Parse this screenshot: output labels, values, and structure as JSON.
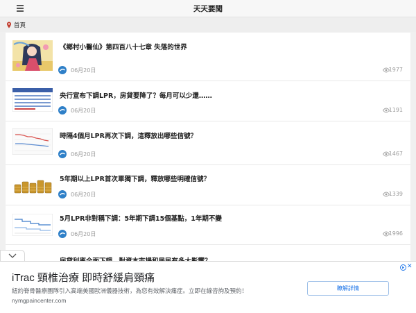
{
  "header": {
    "title": "天天要聞",
    "menu_icon": "hamburger-menu-icon"
  },
  "breadcrumb": {
    "icon": "location-pin-icon",
    "label": "首頁"
  },
  "articles": [
    {
      "title": "《鄉村小醫仙》第四百八十七章 失落的世界",
      "date": "06月20日",
      "views": "1977",
      "thumb": "anime-girl-thumbnail"
    },
    {
      "title": "央行宣布下調LPR，房貸要降了？每月可以少還……",
      "date": "06月20日",
      "views": "1191",
      "thumb": "rate-table-thumbnail"
    },
    {
      "title": "時隔4個月LPR再次下調，這釋放出哪些信號？",
      "date": "06月20日",
      "views": "1467",
      "thumb": "line-chart-thumbnail"
    },
    {
      "title": "5年期以上LPR首次單獨下調，釋放哪些明確信號？",
      "date": "06月20日",
      "views": "1339",
      "thumb": "coins-thumbnail"
    },
    {
      "title": "5月LPR非對稱下調：5年期下調15個基點，1年期不變",
      "date": "06月20日",
      "views": "1996",
      "thumb": "step-chart-thumbnail"
    },
    {
      "title": "房貸利率全面下調，對資本市場和居民有多大影響？"
    }
  ],
  "ad": {
    "title": "iTrac 頸椎治療 即時舒緩肩頸痛",
    "description": "紐約脊骨醫療團隊引入高端美國歐洲儀器技術，為您有效解決痛症。立即在線咨詢及預約！",
    "url": "nymgpaincenter.com",
    "button_label": "瞭解詳情",
    "close_label": "✕",
    "adchoices_icon": "adchoices-icon"
  },
  "colors": {
    "ad_accent": "#1a73e8",
    "source_icon": "#2f80c8",
    "pin": "#c0392b"
  }
}
